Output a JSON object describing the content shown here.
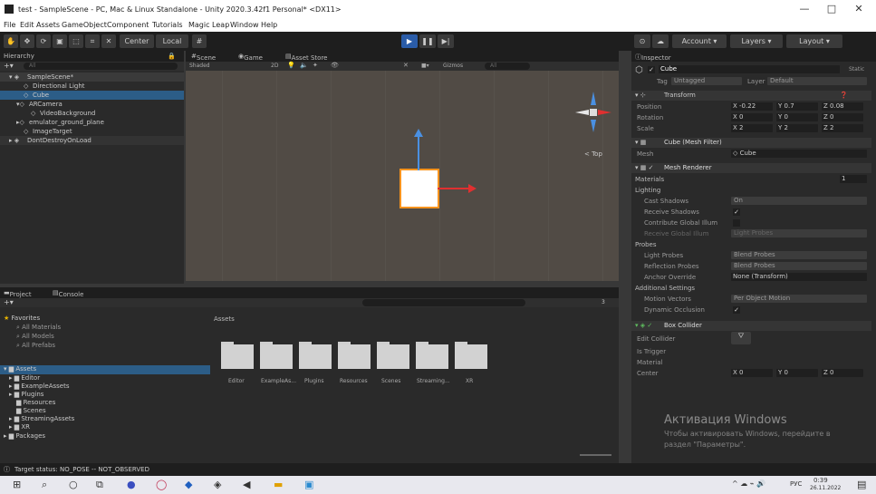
{
  "window": {
    "title": "test - SampleScene - PC, Mac & Linux Standalone - Unity 2020.3.42f1 Personal* <DX11>",
    "controls": [
      "—",
      "□",
      "✕"
    ]
  },
  "menu": [
    "File",
    "Edit",
    "Assets",
    "GameObject",
    "Component",
    "Tutorials",
    "Magic Leap",
    "Window",
    "Help"
  ],
  "toolbar": {
    "pivot_label": "Center",
    "space_label": "Local",
    "account_label": "Account",
    "layers_label": "Layers",
    "layout_label": "Layout"
  },
  "hierarchy": {
    "tab": "Hierarchy",
    "search_placeholder": "All",
    "items": [
      {
        "label": "SampleScene*",
        "indent": 0
      },
      {
        "label": "Directional Light",
        "indent": 2
      },
      {
        "label": "Cube",
        "indent": 2
      },
      {
        "label": "ARCamera",
        "indent": 1
      },
      {
        "label": "VideoBackground",
        "indent": 3
      },
      {
        "label": "emulator_ground_plane",
        "indent": 1
      },
      {
        "label": "ImageTarget",
        "indent": 2
      },
      {
        "label": "DontDestroyOnLoad",
        "indent": 0
      }
    ]
  },
  "scene_tabs": {
    "scene": "Scene",
    "game": "Game",
    "asset_store": "Asset Store",
    "shading": "Shaded",
    "mode_2d": "2D",
    "gizmos": "Gizmos",
    "search": "All",
    "view_label": "< Top"
  },
  "project": {
    "tab_project": "Project",
    "tab_console": "Console",
    "favorites_label": "Favorites",
    "favorites": [
      "All Materials",
      "All Models",
      "All Prefabs"
    ],
    "assets_label": "Assets",
    "asset_tree": [
      "Editor",
      "ExampleAssets",
      "Plugins",
      "Resources",
      "Scenes",
      "StreamingAssets",
      "XR"
    ],
    "packages_label": "Packages",
    "breadcrumb": "Assets",
    "folders": [
      "Editor",
      "ExampleAs...",
      "Plugins",
      "Resources",
      "Scenes",
      "Streaming...",
      "XR"
    ],
    "count": "3"
  },
  "inspector": {
    "tab": "Inspector",
    "object_name": "Cube",
    "static_label": "Static",
    "tag_label": "Tag",
    "tag_value": "Untagged",
    "layer_label": "Layer",
    "layer_value": "Default",
    "transform": {
      "title": "Transform",
      "position_label": "Position",
      "rotation_label": "Rotation",
      "scale_label": "Scale",
      "position": [
        "-0.22",
        "0.7",
        "0.08"
      ],
      "rotation": [
        "0",
        "0",
        "0"
      ],
      "scale": [
        "2",
        "2",
        "2"
      ]
    },
    "mesh_filter": {
      "title": "Cube (Mesh Filter)",
      "mesh_label": "Mesh",
      "mesh_value": "Cube"
    },
    "mesh_renderer": {
      "title": "Mesh Renderer",
      "materials_label": "Materials",
      "materials_count": "1",
      "lighting_label": "Lighting",
      "cast_shadows_label": "Cast Shadows",
      "cast_shadows_value": "On",
      "receive_shadows_label": "Receive Shadows",
      "global_illum_label": "Contribute Global Illum",
      "receive_gi_label": "Receive Global Illum",
      "receive_gi_value": "Light Probes",
      "probes_label": "Probes",
      "light_probes_label": "Light Probes",
      "light_probes_value": "Blend Probes",
      "reflection_label": "Reflection Probes",
      "reflection_value": "Blend Probes",
      "anchor_label": "Anchor Override",
      "anchor_value": "None (Transform)",
      "additional_label": "Additional Settings",
      "motion_label": "Motion Vectors",
      "motion_value": "Per Object Motion",
      "dynamic_label": "Dynamic Occlusion"
    },
    "box_collider": {
      "title": "Box Collider",
      "edit_label": "Edit Collider",
      "trigger_label": "Is Trigger",
      "material_label": "Material",
      "center_label": "Center",
      "center_x": "0",
      "center_y": "0",
      "center_z": "0"
    }
  },
  "watermark": {
    "line1": "Активация Windows",
    "line2": "Чтобы активировать Windows, перейдите в",
    "line3": "раздел \"Параметры\"."
  },
  "status": "Target status: NO_POSE -- NOT_OBSERVED",
  "taskbar": {
    "language": "РУС",
    "time": "0:39",
    "date": "26.11.2022"
  },
  "colors": {
    "selection": "#2c5d87",
    "play_button": "#2a5ca8",
    "cube_outline": "#f7931e",
    "axis_x": "#e03030",
    "axis_y": "#4a90e2"
  }
}
